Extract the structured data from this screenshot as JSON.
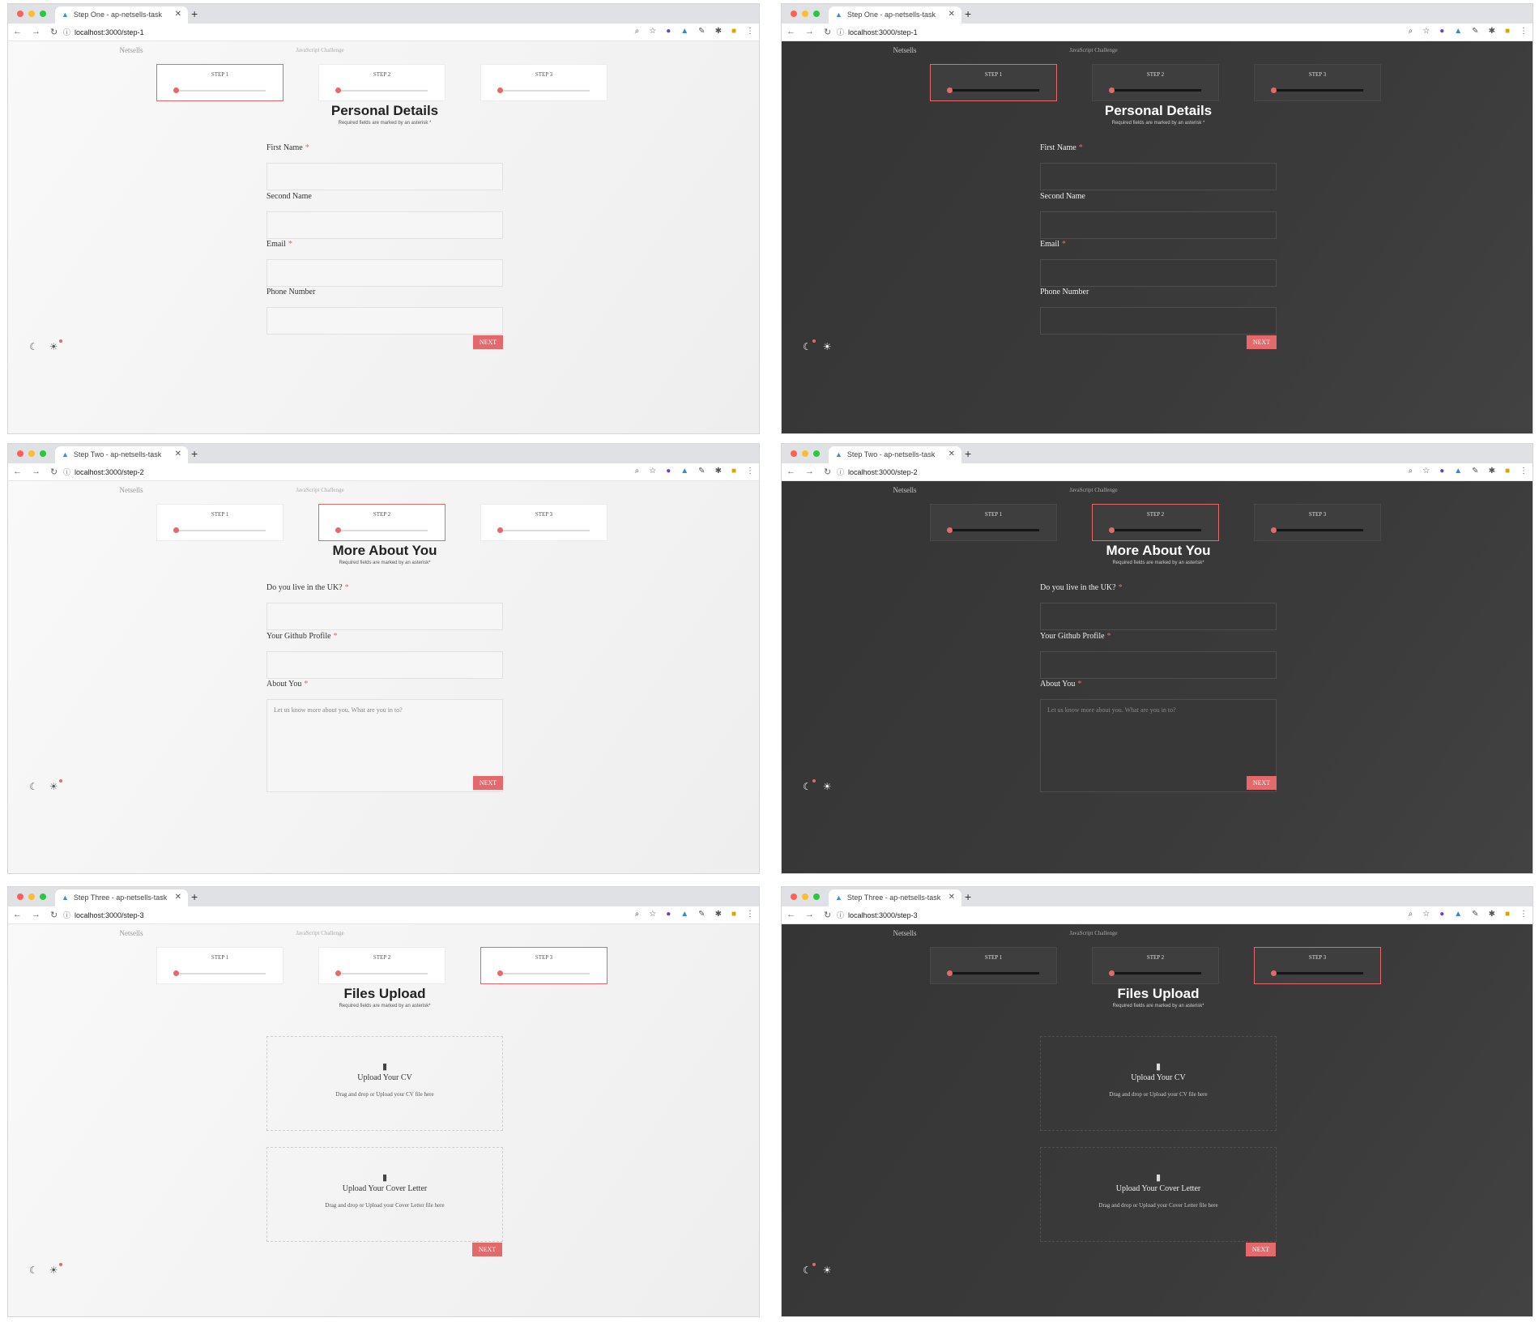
{
  "browser": {
    "tab_icon": "▲",
    "close_icon": "✕",
    "new_tab_icon": "+",
    "back_icon": "←",
    "forward_icon": "→",
    "reload_icon": "↻",
    "lock_icon": "ⓘ",
    "zoom_icon": "⌕",
    "bookmark_icon": "☆",
    "ext_icon_1": "●",
    "ext_icon_2": "▲",
    "ext_icon_3": "✎",
    "ext_icon_4": "✱",
    "ext_icon_5": "■",
    "menu_icon": "⋮"
  },
  "brand": "Netsells",
  "challenge": "JavaScript Challenge",
  "steps": [
    "STEP 1",
    "STEP 2",
    "STEP 3"
  ],
  "next_label": "NEXT",
  "moon_icon": "☾",
  "sun_icon": "☀",
  "accent_color": "#e4696a",
  "step1": {
    "tab_title": "Step One - ap-netsells-task",
    "url": "localhost:3000/step-1",
    "title": "Personal Details",
    "subtitle": "Required fields are marked by an asterisk *",
    "fields": [
      "First Name",
      "Second Name",
      "Email",
      "Phone Number"
    ],
    "required_mark": "*"
  },
  "step2": {
    "tab_title": "Step Two - ap-netsells-task",
    "url": "localhost:3000/step-2",
    "title": "More About You",
    "subtitle": "Required fields are marked by an asterisk*",
    "fields": [
      "Do you live in the UK?",
      "Your Github Profile",
      "About You"
    ],
    "about_placeholder": "Let us know more about you. What are you in to?",
    "required_mark": "*"
  },
  "step3": {
    "tab_title": "Step Three - ap-netsells-task",
    "url": "localhost:3000/step-3",
    "title": "Files Upload",
    "subtitle": "Required fields are marked by an asterisk*",
    "file_icon": "▮",
    "cv_title": "Upload Your CV",
    "cv_sub": "Drag and drop or Upload your CV file here",
    "cover_title": "Upload Your Cover Letter",
    "cover_sub": "Drag and drop or Upload your Cover Letter file here"
  }
}
